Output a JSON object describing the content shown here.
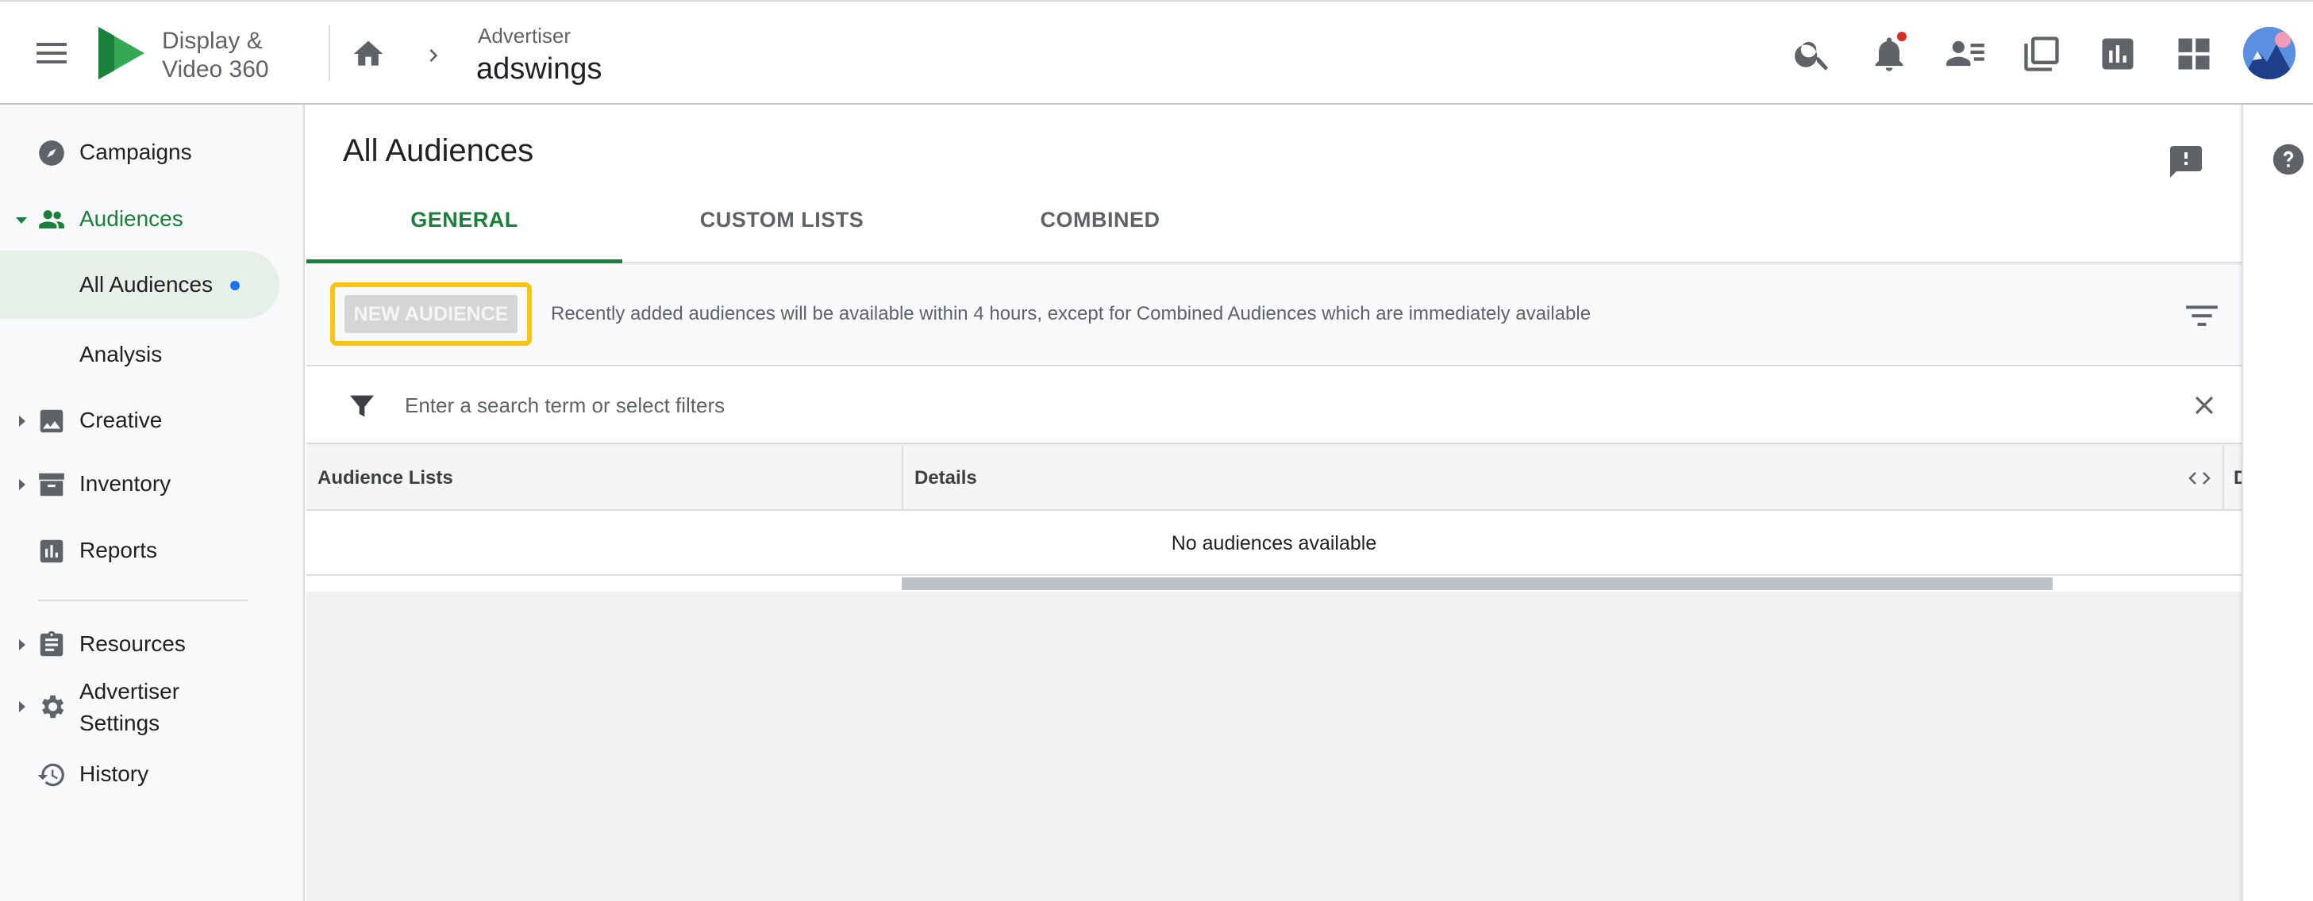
{
  "app": {
    "product_name": "Display & Video 360",
    "breadcrumb_label": "Advertiser",
    "breadcrumb_value": "adswings"
  },
  "topbar_icons": [
    "search-icon",
    "notifications-icon",
    "contacts-icon",
    "copy-icon",
    "reports-icon",
    "apps-grid-icon"
  ],
  "sidebar": {
    "items": [
      {
        "label": "Campaigns",
        "icon": "compass-icon"
      },
      {
        "label": "Audiences",
        "icon": "people-icon"
      },
      {
        "label": "All Audiences"
      },
      {
        "label": "Analysis"
      },
      {
        "label": "Creative",
        "icon": "image-icon"
      },
      {
        "label": "Inventory",
        "icon": "archive-icon"
      },
      {
        "label": "Reports",
        "icon": "bar-chart-icon"
      },
      {
        "label": "Resources",
        "icon": "clipboard-icon"
      },
      {
        "label": "Advertiser Settings",
        "icon": "gear-icon"
      },
      {
        "label": "History",
        "icon": "history-icon"
      }
    ]
  },
  "main": {
    "title": "All Audiences",
    "tabs": [
      {
        "label": "GENERAL",
        "active": true
      },
      {
        "label": "CUSTOM LISTS",
        "active": false
      },
      {
        "label": "COMBINED",
        "active": false
      }
    ],
    "new_audience_label": "NEW AUDIENCE",
    "info_text": "Recently added audiences will be available within 4 hours, except for Combined Audiences which are immediately available",
    "search_placeholder": "Enter a search term or select filters",
    "table": {
      "columns": [
        "Audience Lists",
        "Details",
        "D"
      ],
      "empty_message": "No audiences available"
    }
  },
  "colors": {
    "accent_green": "#188038",
    "highlight_yellow": "#f9c510",
    "notification_red": "#d93025",
    "selected_bg": "#e6f0e8"
  }
}
